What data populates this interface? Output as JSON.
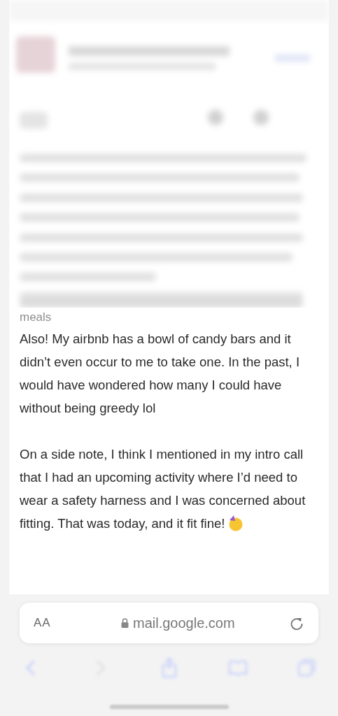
{
  "message": {
    "trailing_line": "meals",
    "paragraphs": [
      "Also! My airbnb has a bowl of candy bars and it didn’t even occur to me to take one. In the past, I would have wondered how many I could have without being greedy lol",
      "On a side note, I think I mentioned in my intro call that I had an upcoming activity where I’d need to wear a safety harness and I was concerned about fitting. That was today, and it fit fine!"
    ]
  },
  "address_bar": {
    "text_size_label": "AA",
    "url": "mail.google.com"
  }
}
